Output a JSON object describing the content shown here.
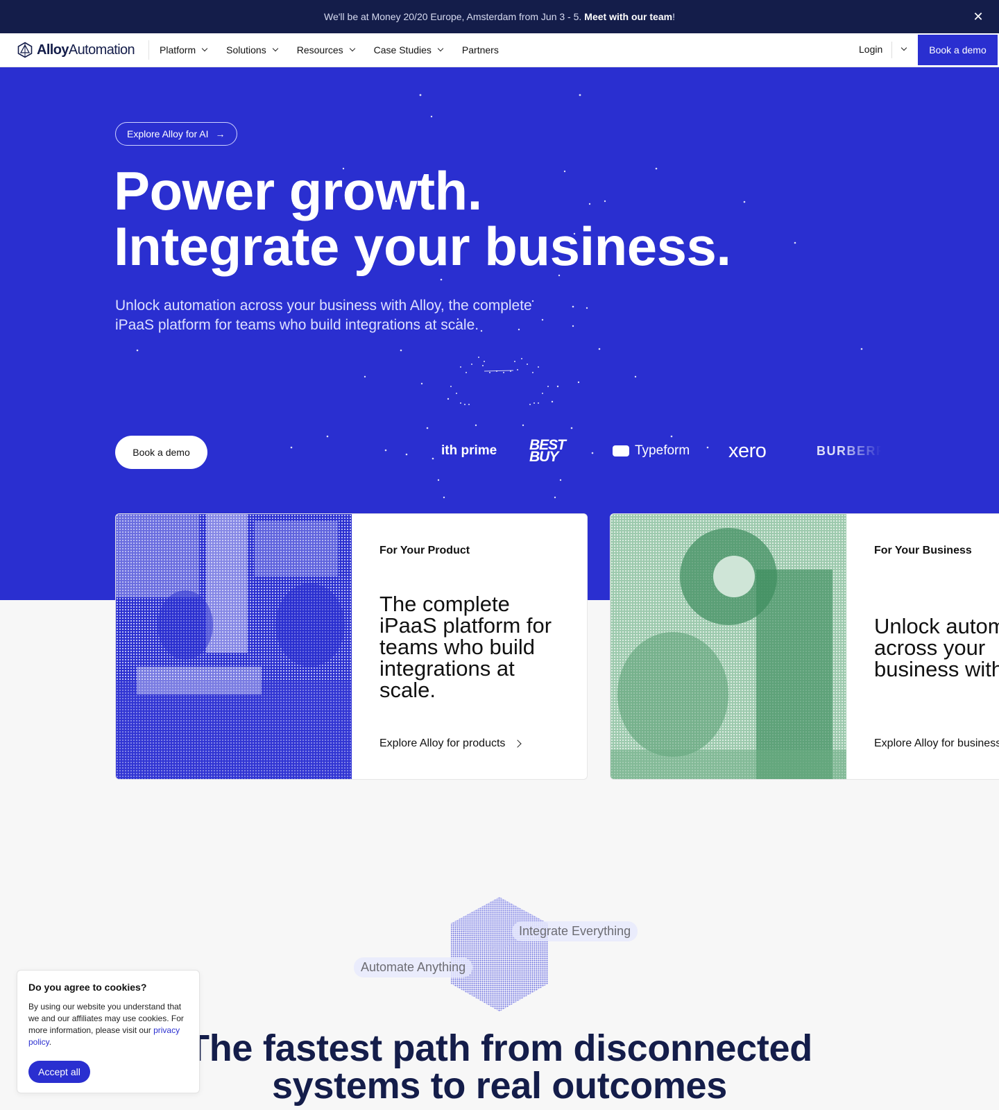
{
  "announcement": {
    "text": "We'll be at Money 20/20 Europe, Amsterdam from Jun 3 - 5.",
    "link": "Meet with our team",
    "suffix": "!",
    "close_icon": "close-icon"
  },
  "nav": {
    "logo_bold": "Alloy",
    "logo_rest": "Automation",
    "items": [
      {
        "label": "Platform",
        "has_dropdown": true
      },
      {
        "label": "Solutions",
        "has_dropdown": true
      },
      {
        "label": "Resources",
        "has_dropdown": true
      },
      {
        "label": "Case Studies",
        "has_dropdown": true
      },
      {
        "label": "Partners",
        "has_dropdown": false
      }
    ],
    "login": "Login",
    "cta": "Book a demo"
  },
  "hero": {
    "pill": "Explore Alloy for AI",
    "pill_arrow": "→",
    "title_line1": "Power growth.",
    "title_line2": "Integrate your business.",
    "subtitle": "Unlock automation across your business with Alloy, the complete iPaaS platform for teams who build integrations at scale.",
    "cta": "Book a demo",
    "bg_color": "#2a2fd0",
    "logos": {
      "prime": "ith prime",
      "bestbuy_line1": "BEST",
      "bestbuy_line2": "BUY",
      "typeform": "Typeform",
      "xero": "xero",
      "burberry": "BURBERRY"
    }
  },
  "cards": [
    {
      "eyebrow": "For Your Product",
      "title": "The complete iPaaS platform for teams who build integrations at scale.",
      "link": "Explore Alloy for products",
      "tint": "#2a2fd0"
    },
    {
      "eyebrow": "For Your Business",
      "title_line1": "Unlock automation",
      "title_line2": "across your",
      "title_line3": "business with Alloy",
      "link": "Explore Alloy for business",
      "tint": "#4a9a6a"
    }
  ],
  "graphic": {
    "label_integrate": "Integrate Everything",
    "label_automate": "Automate Anything"
  },
  "section": {
    "title_line1": "The fastest path from disconnected",
    "title_line2": "systems to real outcomes"
  },
  "cookie": {
    "title": "Do you agree to cookies?",
    "body": "By using our website you understand that we and our affiliates may use cookies. For more information, please visit our",
    "link": "privacy policy",
    "period": ".",
    "button": "Accept all"
  }
}
